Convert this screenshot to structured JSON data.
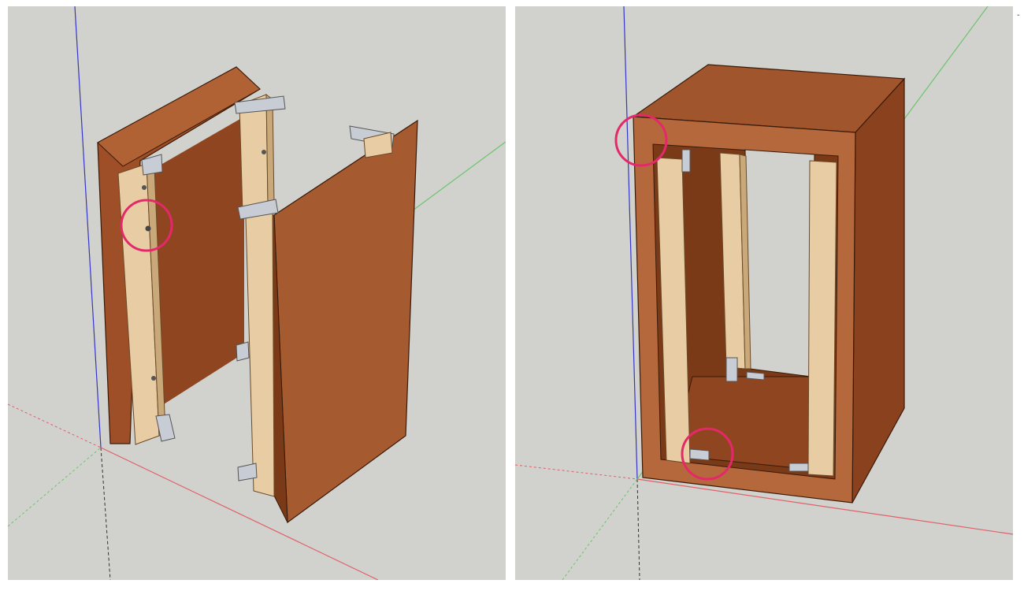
{
  "colors": {
    "background": "#d1d1cd",
    "axis_red": "#e0616a",
    "axis_green": "#6dc46d",
    "axis_blue": "#3535c8",
    "panel_dark": "#8a421e",
    "panel_mid": "#a0522d",
    "panel_light": "#b86a3e",
    "edge_dark": "#5a2a10",
    "stud": "#e8cda4",
    "stud_shadow": "#c9a87a",
    "bracket": "#c8ccd4",
    "highlight_circle": "#e5286a"
  },
  "viewports": [
    {
      "label": "exploded-cabinet-view",
      "highlights": [
        "cam-bolt-screw"
      ]
    },
    {
      "label": "assembled-cabinet-view",
      "highlights": [
        "top-corner-joint",
        "bottom-corner-bracket"
      ]
    }
  ],
  "corner_mark": "-"
}
